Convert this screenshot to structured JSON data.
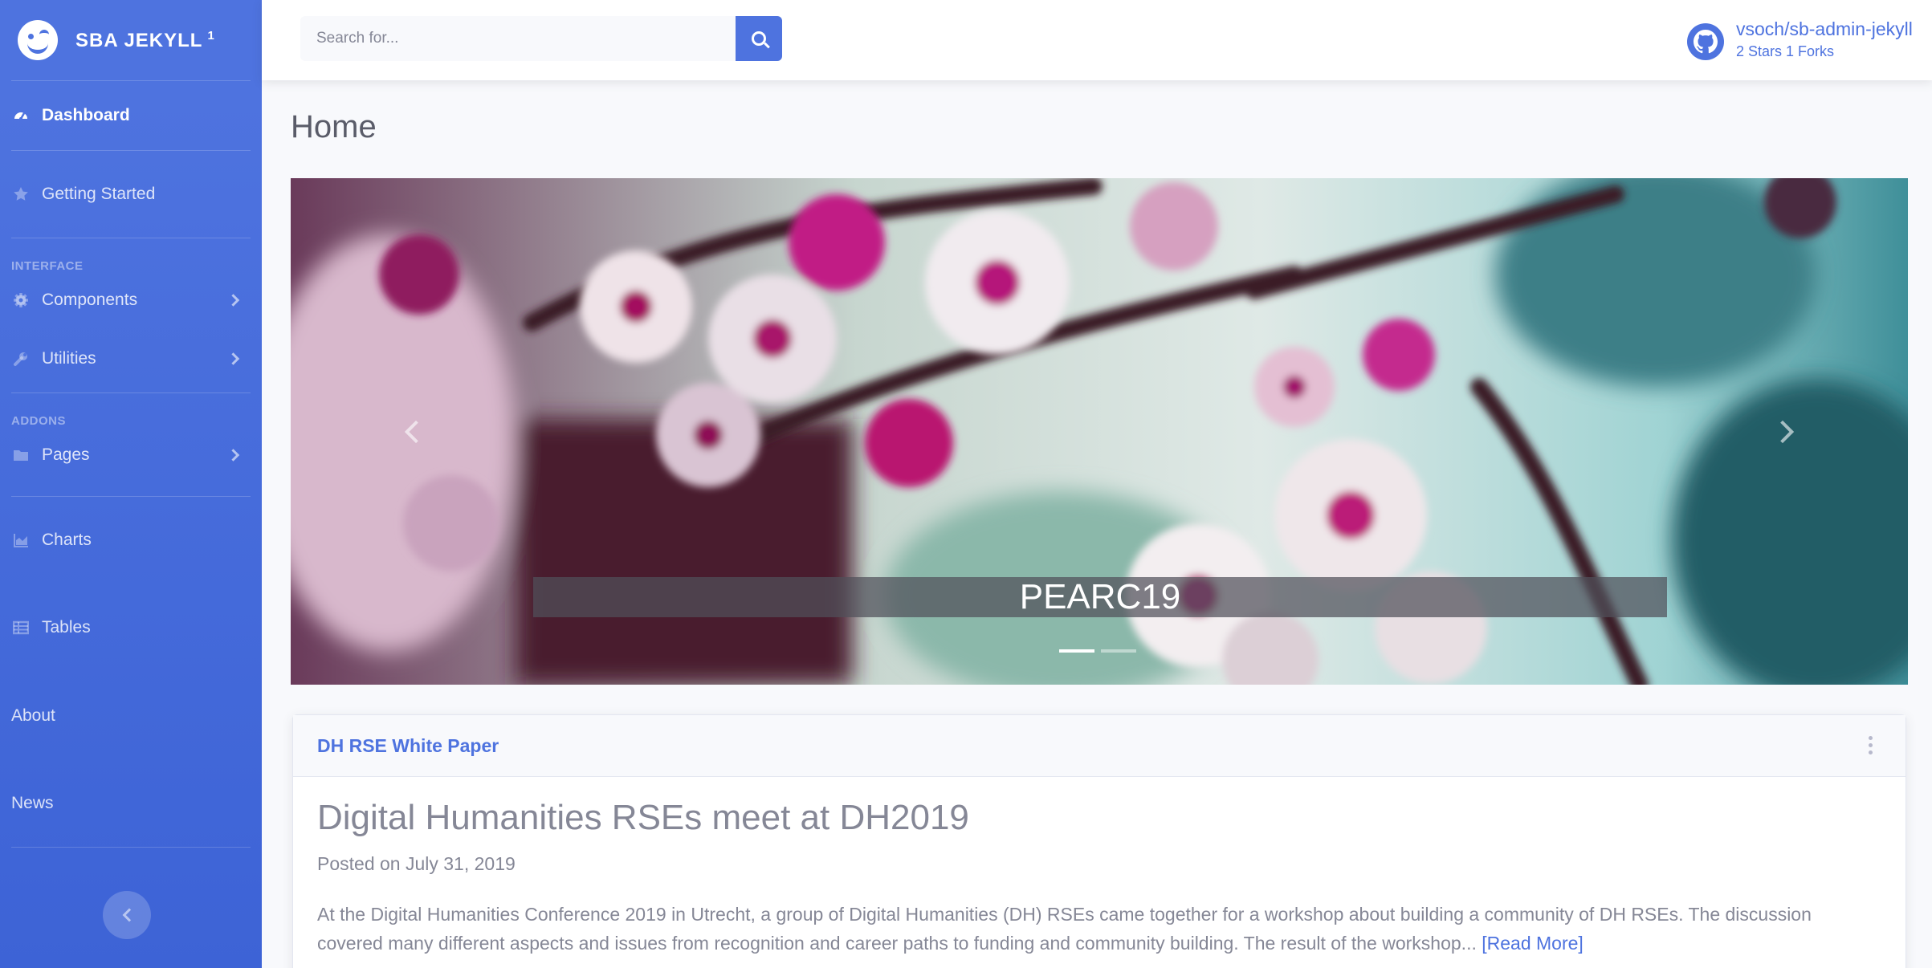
{
  "brand": {
    "name": "SBA JEKYLL",
    "version": "1"
  },
  "sidebar": {
    "dashboard": "Dashboard",
    "getting_started": "Getting Started",
    "heading_interface": "INTERFACE",
    "components": "Components",
    "utilities": "Utilities",
    "heading_addons": "ADDONS",
    "pages": "Pages",
    "charts": "Charts",
    "tables": "Tables",
    "about": "About",
    "news": "News"
  },
  "search": {
    "placeholder": "Search for..."
  },
  "repo": {
    "name": "vsoch/sb-admin-jekyll",
    "stats": "2 Stars  1 Forks"
  },
  "main": {
    "title": "Home",
    "carousel": {
      "caption": "PEARC19",
      "slide_count": 2,
      "active_slide": 1
    },
    "card": {
      "header": "DH RSE White Paper",
      "post_title": "Digital Humanities RSEs meet at DH2019",
      "posted_on": "Posted on July 31, 2019",
      "excerpt": "At the Digital Humanities Conference 2019 in Utrecht, a group of Digital Humanities (DH) RSEs came together for a workshop about building a community of DH RSEs. The discussion covered many different aspects and issues from recognition and career paths to funding and community building. The result of the workshop...",
      "read_more": "[Read More]"
    }
  },
  "colors": {
    "primary": "#4e73df",
    "text_muted": "#858796",
    "bg": "#f8f9fc"
  }
}
